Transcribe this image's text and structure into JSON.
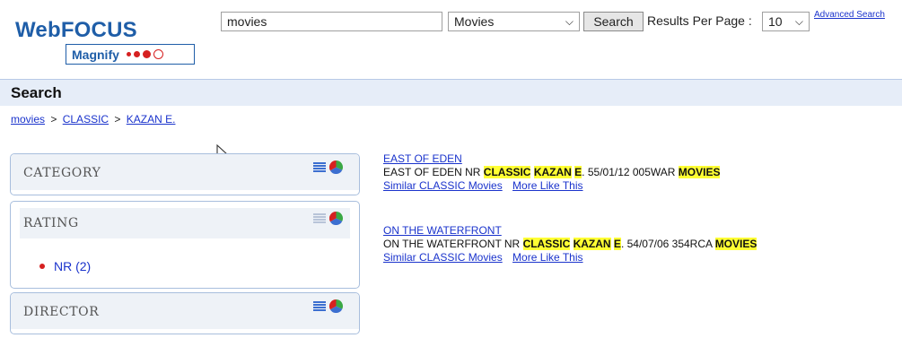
{
  "logo": {
    "title": "WebFOCUS",
    "subtitle": "Magnify"
  },
  "search": {
    "query": "movies",
    "type": "Movies",
    "button": "Search",
    "rpp_label": "Results Per Page :",
    "rpp_value": "10",
    "advanced": "Advanced Search"
  },
  "page": {
    "title": "Search"
  },
  "breadcrumb": {
    "root": "movies",
    "sep1": ">",
    "level1": "CLASSIC",
    "sep2": ">",
    "level2": "KAZAN E."
  },
  "facets": {
    "category": "CATEGORY",
    "rating": "RATING",
    "rating_item": "NR (2)",
    "director": "DIRECTOR"
  },
  "results": [
    {
      "title": "EAST OF EDEN",
      "pre": "EAST OF EDEN NR ",
      "h1": "CLASSIC",
      "h2": "KAZAN",
      "h3": "E",
      "mid": ". 55/01/12 005WAR ",
      "h4": "MOVIES",
      "link1": "Similar CLASSIC Movies",
      "link2": "More Like This"
    },
    {
      "title": "ON THE WATERFRONT",
      "pre": "ON THE WATERFRONT NR ",
      "h1": "CLASSIC",
      "h2": "KAZAN",
      "h3": "E",
      "mid": ". 54/07/06 354RCA ",
      "h4": "MOVIES",
      "link1": "Similar CLASSIC Movies",
      "link2": "More Like This"
    }
  ],
  "colors": {
    "brand": "#1f5ea8",
    "link": "#1a33cc",
    "highlight": "#ffff33",
    "accent_red": "#d62020"
  }
}
